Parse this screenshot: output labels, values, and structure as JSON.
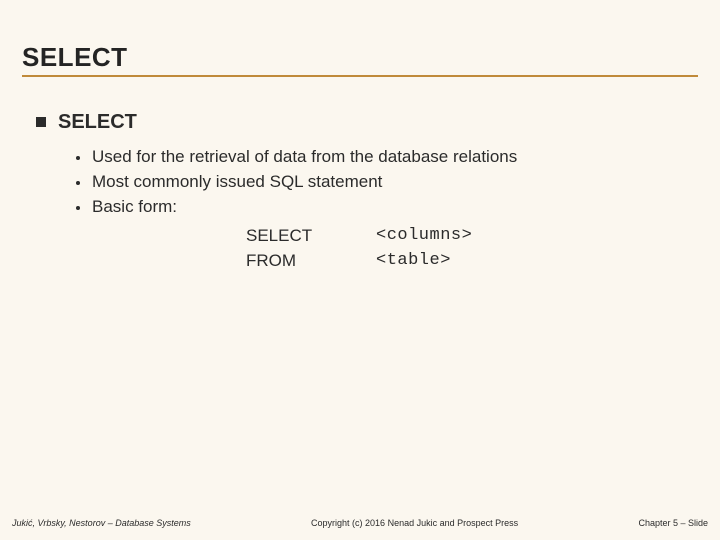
{
  "title": "SELECT",
  "main": {
    "heading": "SELECT",
    "points": [
      "Used for the retrieval of data from the database relations",
      "Most commonly issued SQL statement",
      "Basic form:"
    ],
    "code": [
      {
        "keyword": "SELECT",
        "arg": "<columns>"
      },
      {
        "keyword": "FROM",
        "arg": "<table>"
      }
    ]
  },
  "footer": {
    "left": "Jukić, Vrbsky, Nestorov – Database Systems",
    "center": "Copyright (c) 2016 Nenad Jukic and Prospect Press",
    "right": "Chapter 5 – Slide"
  }
}
